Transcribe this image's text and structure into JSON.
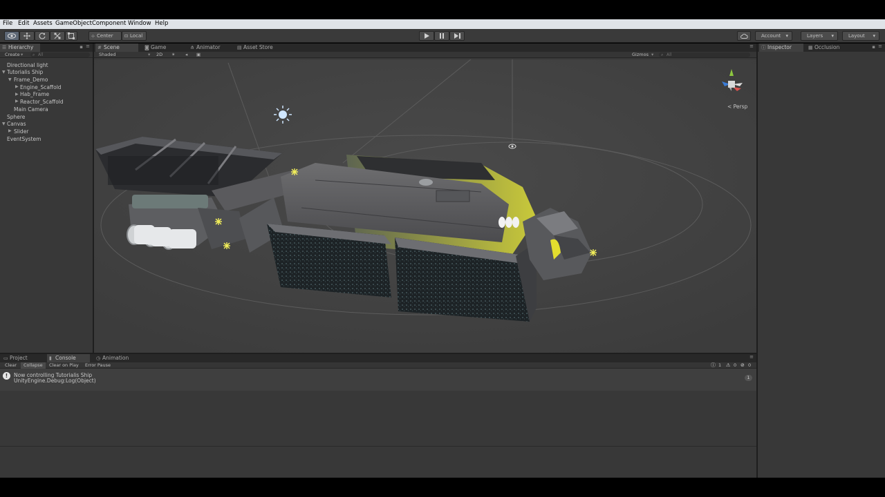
{
  "menu": [
    "File",
    "Edit",
    "Assets",
    "GameObject",
    "Component",
    "Window",
    "Help"
  ],
  "toolbar": {
    "pivot": "Center",
    "space": "Local",
    "account": "Account",
    "layers": "Layers",
    "layout": "Layout"
  },
  "hierarchy": {
    "tab": "Hierarchy",
    "create": "Create",
    "search_placeholder": "All",
    "items": [
      "Directional light",
      "Tutorialis Ship",
      "Frame_Demo",
      "Engine_Scaffold",
      "Hab_Frame",
      "Reactor_Scaffold",
      "Main Camera",
      "Sphere",
      "Canvas",
      "Slider",
      "EventSystem"
    ]
  },
  "scene": {
    "tabs": [
      "Scene",
      "Game",
      "Animator",
      "Asset Store"
    ],
    "shading": "Shaded",
    "mode2d": "2D",
    "gizmos": "Gizmos",
    "search_placeholder": "All",
    "persp": "Persp"
  },
  "inspector": {
    "tabs": [
      "Inspector",
      "Occlusion"
    ]
  },
  "bottom": {
    "tabs": [
      "Project",
      "Console",
      "Animation"
    ],
    "buttons": [
      "Clear",
      "Collapse",
      "Clear on Play",
      "Error Pause"
    ],
    "counts": {
      "info": "1",
      "warn": "0",
      "error": "0"
    },
    "log": {
      "message": "Now controlling Tutorialis Ship",
      "source": "UnityEngine.Debug:Log(Object)",
      "count": "1"
    }
  },
  "colors": {
    "panel": "#383838",
    "scene_bg": "#414141",
    "menubar": "#dfe3e8",
    "accent_yellow": "#e8e23a"
  }
}
